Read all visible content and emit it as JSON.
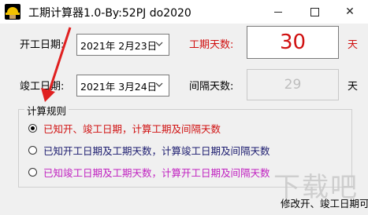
{
  "window": {
    "title": "工期计算器1.0-By:52PJ do2020",
    "minimize_icon": "minimize-icon",
    "maximize_icon": "maximize-icon",
    "close_icon": "close-icon",
    "close_glyph": "✕"
  },
  "form": {
    "start_label": "开工日期:",
    "start_date": "2021年  2月23日",
    "end_label": "竣工日期:",
    "end_date": "2021年  3月24日",
    "duration_label": "工期天数:",
    "duration_value": "30",
    "duration_unit": "天",
    "interval_label": "间隔天数:",
    "interval_value": "29",
    "interval_unit": "天"
  },
  "rules": {
    "legend": "计算规则",
    "options": [
      {
        "label": "已知开、竣工日期，计算工期及间隔天数",
        "selected": true,
        "color": "#d01010"
      },
      {
        "label": "已知开工日期及工期天数，计算竣工日期及间隔天数",
        "selected": false,
        "color": "#1a1a6e"
      },
      {
        "label": "已知竣工日期及工期天数，计算开工日期及间隔天数",
        "selected": false,
        "color": "#c020c0"
      }
    ]
  },
  "status": {
    "text": "修改开、竣工日期可"
  },
  "colors": {
    "accent_red": "#d01010",
    "annotation_arrow": "#e02020"
  }
}
